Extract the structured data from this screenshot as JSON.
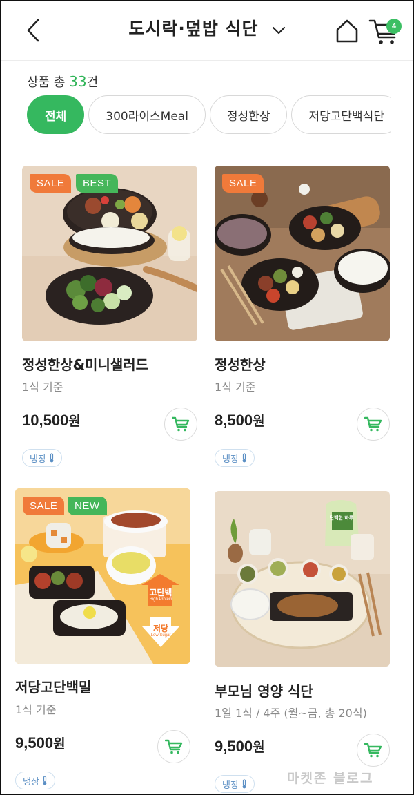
{
  "header": {
    "title": "도시락·덮밥 식단",
    "cart_count": "4"
  },
  "count": {
    "prefix": "상품 총 ",
    "number": "33",
    "suffix": "건"
  },
  "chips": [
    "전체",
    "300라이스Meal",
    "정성한상",
    "저당고단백식단"
  ],
  "products": [
    {
      "name": "정성한상&미니샐러드",
      "sub": "1식 기준",
      "price": "10,500",
      "unit": "원",
      "badges": [
        "SALE",
        "BEST"
      ],
      "storage": "냉장"
    },
    {
      "name": "정성한상",
      "sub": "1식 기준",
      "price": "8,500",
      "unit": "원",
      "badges": [
        "SALE"
      ],
      "storage": "냉장"
    },
    {
      "name": "저당고단백밀",
      "sub": "1식 기준",
      "price": "9,500",
      "unit": "원",
      "badges": [
        "SALE",
        "NEW"
      ],
      "storage": "냉장",
      "image_text": {
        "high": "고단백",
        "high_en": "High Protein",
        "low": "저당",
        "low_en": "Low Sugar"
      }
    },
    {
      "name": "부모님 영양 식단",
      "sub": "1일 1식 / 4주 (월~금, 총 20식)",
      "price": "9,500",
      "unit": "원",
      "badges": [],
      "storage": "냉장",
      "image_text": {
        "pack": "단백한 하루"
      }
    }
  ],
  "watermark": "마켓존 블로그",
  "colors": {
    "accent": "#35b85f",
    "sale": "#f07a3a",
    "best": "#45b65a"
  }
}
